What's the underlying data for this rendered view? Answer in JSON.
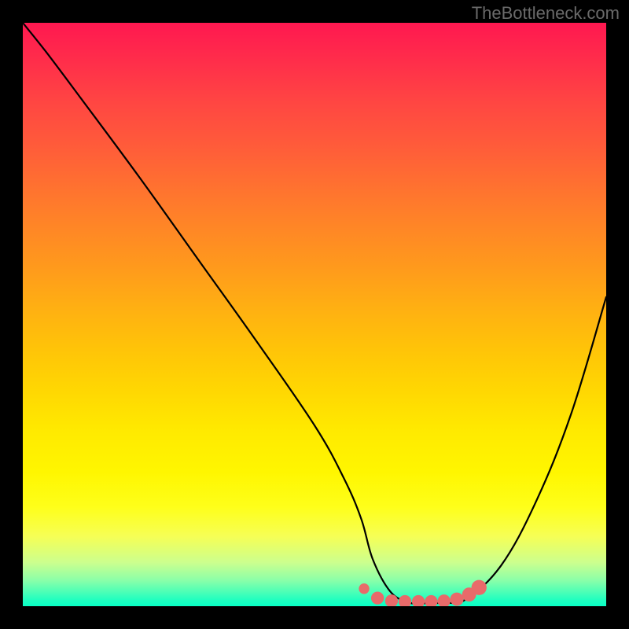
{
  "watermark": "TheBottleneck.com",
  "colors": {
    "frame": "#000000",
    "curve": "#000000",
    "marker_fill": "#e86a6a",
    "marker_stroke": "#e86a6a"
  },
  "chart_data": {
    "type": "line",
    "title": "",
    "xlabel": "",
    "ylabel": "",
    "xlim": [
      0,
      100
    ],
    "ylim": [
      0,
      100
    ],
    "grid": false,
    "legend": false,
    "series": [
      {
        "name": "bottleneck-curve",
        "x": [
          0,
          4,
          10,
          20,
          30,
          40,
          50,
          55,
          58,
          60,
          63,
          66,
          68,
          72,
          76,
          82,
          88,
          94,
          100
        ],
        "y": [
          100,
          95,
          87,
          73.5,
          59.5,
          45.5,
          31,
          22,
          15,
          8,
          2.5,
          0.7,
          0.5,
          0.6,
          1.2,
          7,
          18,
          33,
          53
        ]
      }
    ],
    "markers": [
      {
        "x": 58.5,
        "y": 3.0,
        "r": 0.9
      },
      {
        "x": 60.8,
        "y": 1.4,
        "r": 1.1
      },
      {
        "x": 63.2,
        "y": 0.9,
        "r": 1.1
      },
      {
        "x": 65.5,
        "y": 0.8,
        "r": 1.1
      },
      {
        "x": 67.8,
        "y": 0.8,
        "r": 1.1
      },
      {
        "x": 70.0,
        "y": 0.8,
        "r": 1.1
      },
      {
        "x": 72.2,
        "y": 0.9,
        "r": 1.1
      },
      {
        "x": 74.4,
        "y": 1.2,
        "r": 1.15
      },
      {
        "x": 76.5,
        "y": 2.0,
        "r": 1.2
      },
      {
        "x": 78.2,
        "y": 3.2,
        "r": 1.3
      }
    ],
    "background_gradient": {
      "type": "vertical",
      "stops": [
        {
          "pos": 0.0,
          "color": "#ff1850"
        },
        {
          "pos": 0.5,
          "color": "#ffb012"
        },
        {
          "pos": 0.8,
          "color": "#feff1a"
        },
        {
          "pos": 1.0,
          "color": "#08ffc5"
        }
      ]
    }
  }
}
